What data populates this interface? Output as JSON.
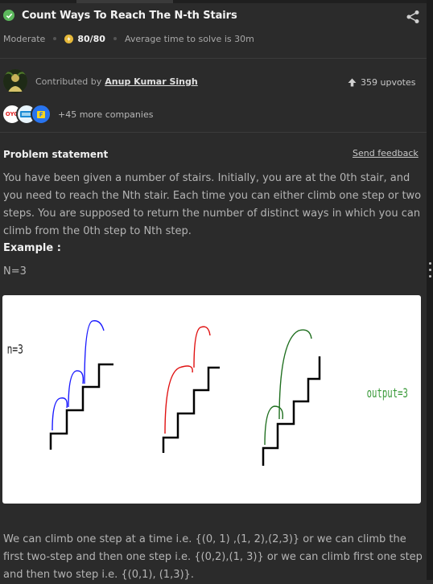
{
  "problem": {
    "title": "Count Ways To Reach The N-th Stairs",
    "difficulty": "Moderate",
    "score": "80/80",
    "avg_time": "Average time to solve is 30m",
    "status_icon": "check-circle-icon"
  },
  "contributor": {
    "prefix": "Contributed by",
    "name": "Anup Kumar Singh",
    "upvotes": "359 upvotes"
  },
  "companies": {
    "logos": [
      "OYO",
      "Paytm",
      "Flipkart"
    ],
    "more": "+45 more companies"
  },
  "statement": {
    "heading": "Problem statement",
    "feedback": "Send feedback",
    "text": "You have been given a number of stairs. Initially, you are at the 0th stair, and you need to reach the Nth stair. Each time you can either climb one step or two steps. You are supposed to return the number of distinct ways in which you can climb from the 0th step to Nth step.",
    "example_label": "Example :",
    "example_input": "N=3",
    "explanation": "We can climb one step at a time i.e. {(0, 1) ,(1, 2),(2,3)} or we can climb the first two-step and then one step i.e. {(0,2),(1, 3)} or we can climb first one step and then two step i.e. {(0,1), (1,3)}."
  },
  "figure": {
    "n_label": "n=3",
    "output_label": "output=3",
    "colors": {
      "path1": "#1a1aff",
      "path2": "#e01010",
      "path3": "#1e6e1e",
      "output": "#3a9a3a"
    }
  },
  "theme": {
    "bg": "#2b2b2b",
    "success": "#5cb85c",
    "coin": "#e6b93a"
  }
}
